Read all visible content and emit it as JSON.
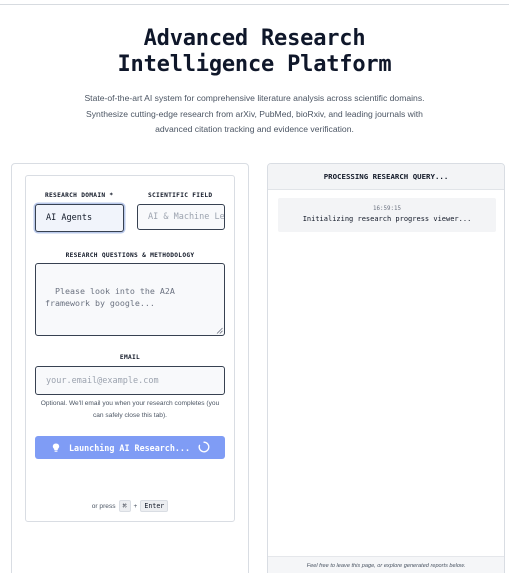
{
  "hero": {
    "title_line1": "Advanced Research",
    "title_line2": "Intelligence Platform",
    "subtitle_line1": "State-of-the-art AI system for comprehensive literature analysis across scientific domains.",
    "subtitle_line2": "Synthesize cutting-edge research from arXiv, PubMed, bioRxiv, and leading journals with",
    "subtitle_line3": "advanced citation tracking and evidence verification."
  },
  "form": {
    "domain_label": "RESEARCH DOMAIN *",
    "domain_value": "AI Agents",
    "field_label": "SCIENTIFIC FIELD",
    "field_placeholder": "AI & Machine Le",
    "questions_label": "RESEARCH QUESTIONS & METHODOLOGY",
    "questions_placeholder": "Please look into the A2A framework by google...",
    "email_label": "EMAIL",
    "email_placeholder": "your.email@example.com",
    "email_note_line1": "Optional. We'll email you when your research completes (you",
    "email_note_line2": "can safely close this tab).",
    "launch_label": "Launching AI Research...",
    "hint_prefix": "or press",
    "hint_key1": "⌘",
    "hint_plus": "+",
    "hint_key2": "Enter"
  },
  "progress": {
    "header": "PROCESSING RESEARCH QUERY...",
    "log": [
      {
        "time": "16:59:15",
        "message": "Initializing research progress viewer..."
      }
    ],
    "footer": "Feel free to leave this page, or explore generated reports below."
  },
  "colors": {
    "launch_button": "#7f9cf5",
    "focus_ring": "#b9c8ea",
    "panel_border": "#d9dde3"
  },
  "icons": {
    "launch": "lightbulb-icon",
    "loading": "spinner-icon",
    "resize": "resize-handle-icon"
  }
}
